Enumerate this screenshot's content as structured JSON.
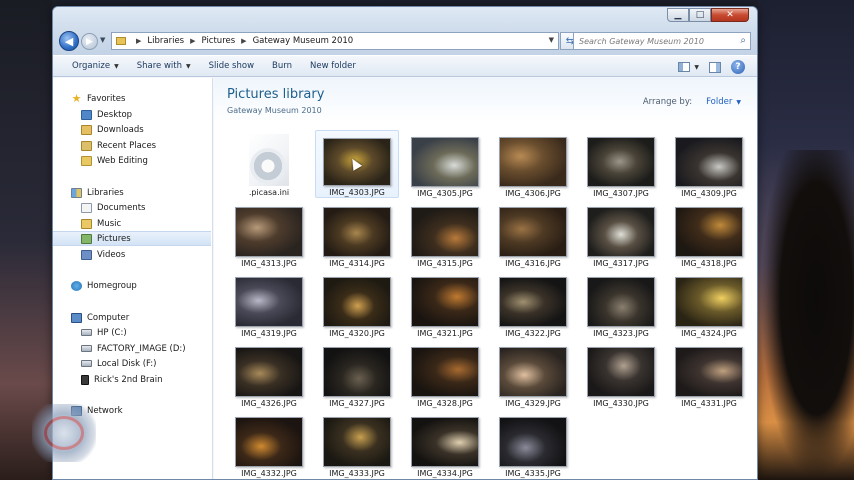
{
  "window": {
    "controls": {
      "minimize": "▁",
      "maximize": "□",
      "close": "✕"
    }
  },
  "address_bar": {
    "crumbs": [
      "Libraries",
      "Pictures",
      "Gateway Museum 2010"
    ]
  },
  "search": {
    "placeholder": "Search Gateway Museum 2010"
  },
  "toolbar": {
    "organize": "Organize",
    "share_with": "Share with",
    "slide_show": "Slide show",
    "burn": "Burn",
    "new_folder": "New folder",
    "help": "?"
  },
  "nav": {
    "favorites": "Favorites",
    "desktop": "Desktop",
    "downloads": "Downloads",
    "recent_places": "Recent Places",
    "web_editing": "Web Editing",
    "libraries": "Libraries",
    "documents": "Documents",
    "music": "Music",
    "pictures": "Pictures",
    "videos": "Videos",
    "homegroup": "Homegroup",
    "computer": "Computer",
    "hp_c": "HP (C:)",
    "factory_image": "FACTORY_IMAGE (D:)",
    "local_disk": "Local Disk (F:)",
    "ricks_brain": "Rick's 2nd Brain",
    "network": "Network"
  },
  "library": {
    "title": "Pictures library",
    "subtitle": "Gateway Museum 2010",
    "arrange_by_label": "Arrange by:",
    "arrange_by_value": "Folder"
  },
  "files": [
    ".picasa.ini",
    "IMG_4303.JPG",
    "IMG_4305.JPG",
    "IMG_4306.JPG",
    "IMG_4307.JPG",
    "IMG_4309.JPG",
    "IMG_4313.JPG",
    "IMG_4314.JPG",
    "IMG_4315.JPG",
    "IMG_4316.JPG",
    "IMG_4317.JPG",
    "IMG_4318.JPG",
    "IMG_4319.JPG",
    "IMG_4320.JPG",
    "IMG_4321.JPG",
    "IMG_4322.JPG",
    "IMG_4323.JPG",
    "IMG_4324.JPG",
    "IMG_4326.JPG",
    "IMG_4327.JPG",
    "IMG_4328.JPG",
    "IMG_4329.JPG",
    "IMG_4330.JPG",
    "IMG_4331.JPG",
    "IMG_4332.JPG",
    "IMG_4333.JPG",
    "IMG_4334.JPG",
    "IMG_4335.JPG"
  ],
  "colors": {
    "library_title": "#1e5f8e",
    "link": "#1f5fbf",
    "selected_nav": "#d3e3f6"
  }
}
